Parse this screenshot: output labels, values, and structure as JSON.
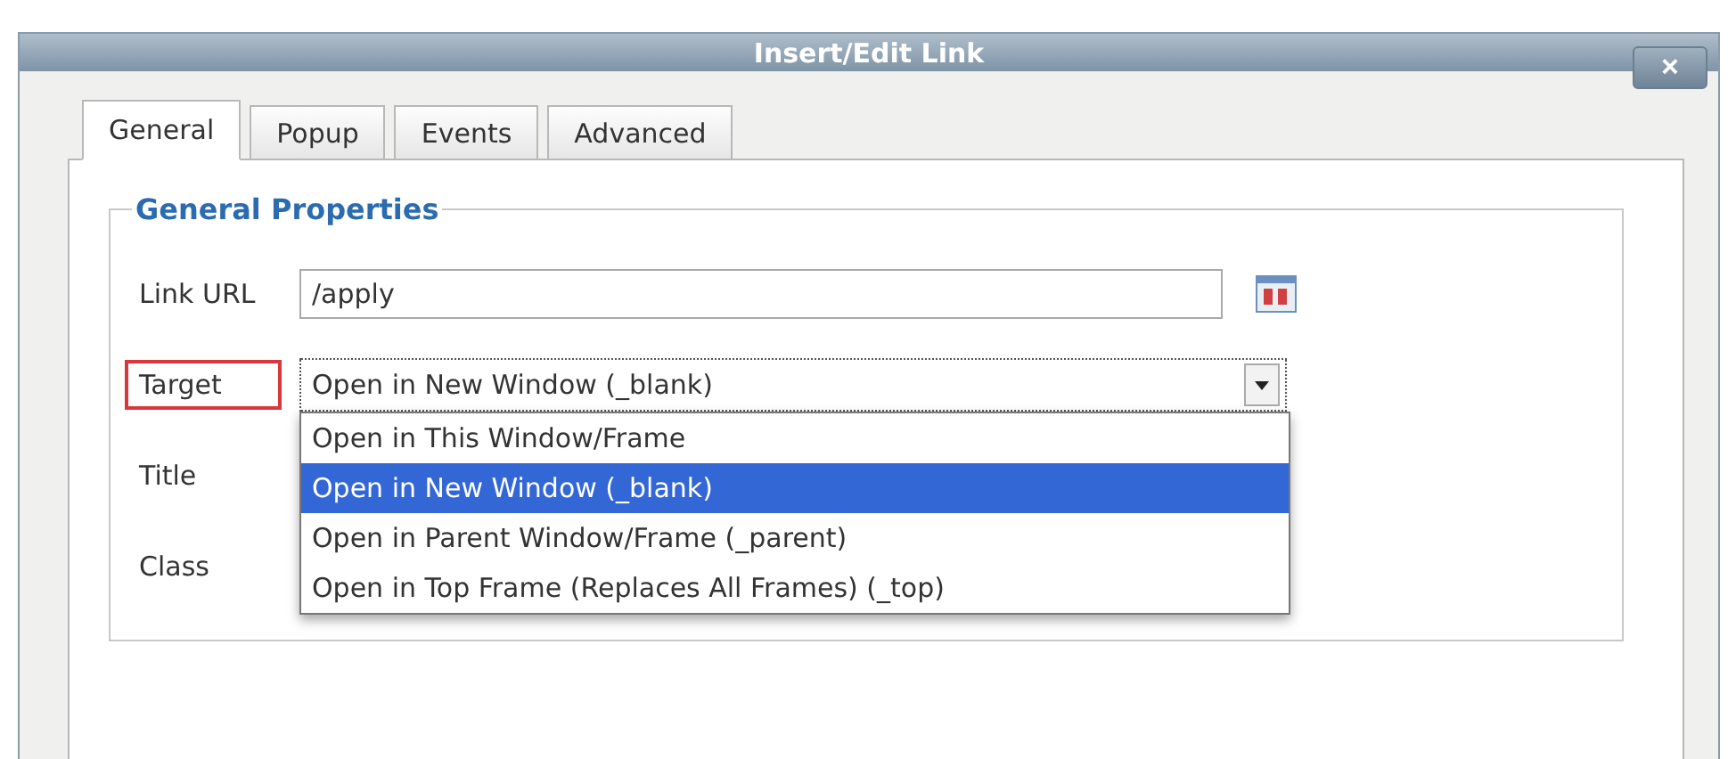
{
  "window": {
    "title": "Insert/Edit Link",
    "close": "×"
  },
  "tabs": [
    {
      "label": "General",
      "selected": true
    },
    {
      "label": "Popup",
      "selected": false
    },
    {
      "label": "Events",
      "selected": false
    },
    {
      "label": "Advanced",
      "selected": false
    }
  ],
  "group": {
    "legend": "General Properties"
  },
  "fields": [
    {
      "kind": "text",
      "label": "Link URL",
      "value": "/apply",
      "highlighted": false,
      "browse": true
    },
    {
      "kind": "select",
      "label": "Target",
      "value": "Open in New Window (_blank)",
      "highlighted": true,
      "expanded": true,
      "options": [
        {
          "label": "Open in This Window/Frame",
          "selected": false
        },
        {
          "label": "Open in New Window (_blank)",
          "selected": true
        },
        {
          "label": "Open in Parent Window/Frame (_parent)",
          "selected": false
        },
        {
          "label": "Open in Top Frame (Replaces All Frames) (_top)",
          "selected": false
        }
      ]
    },
    {
      "kind": "covered",
      "label": "Title",
      "highlighted": false
    },
    {
      "kind": "covered",
      "label": "Class",
      "highlighted": false
    }
  ]
}
